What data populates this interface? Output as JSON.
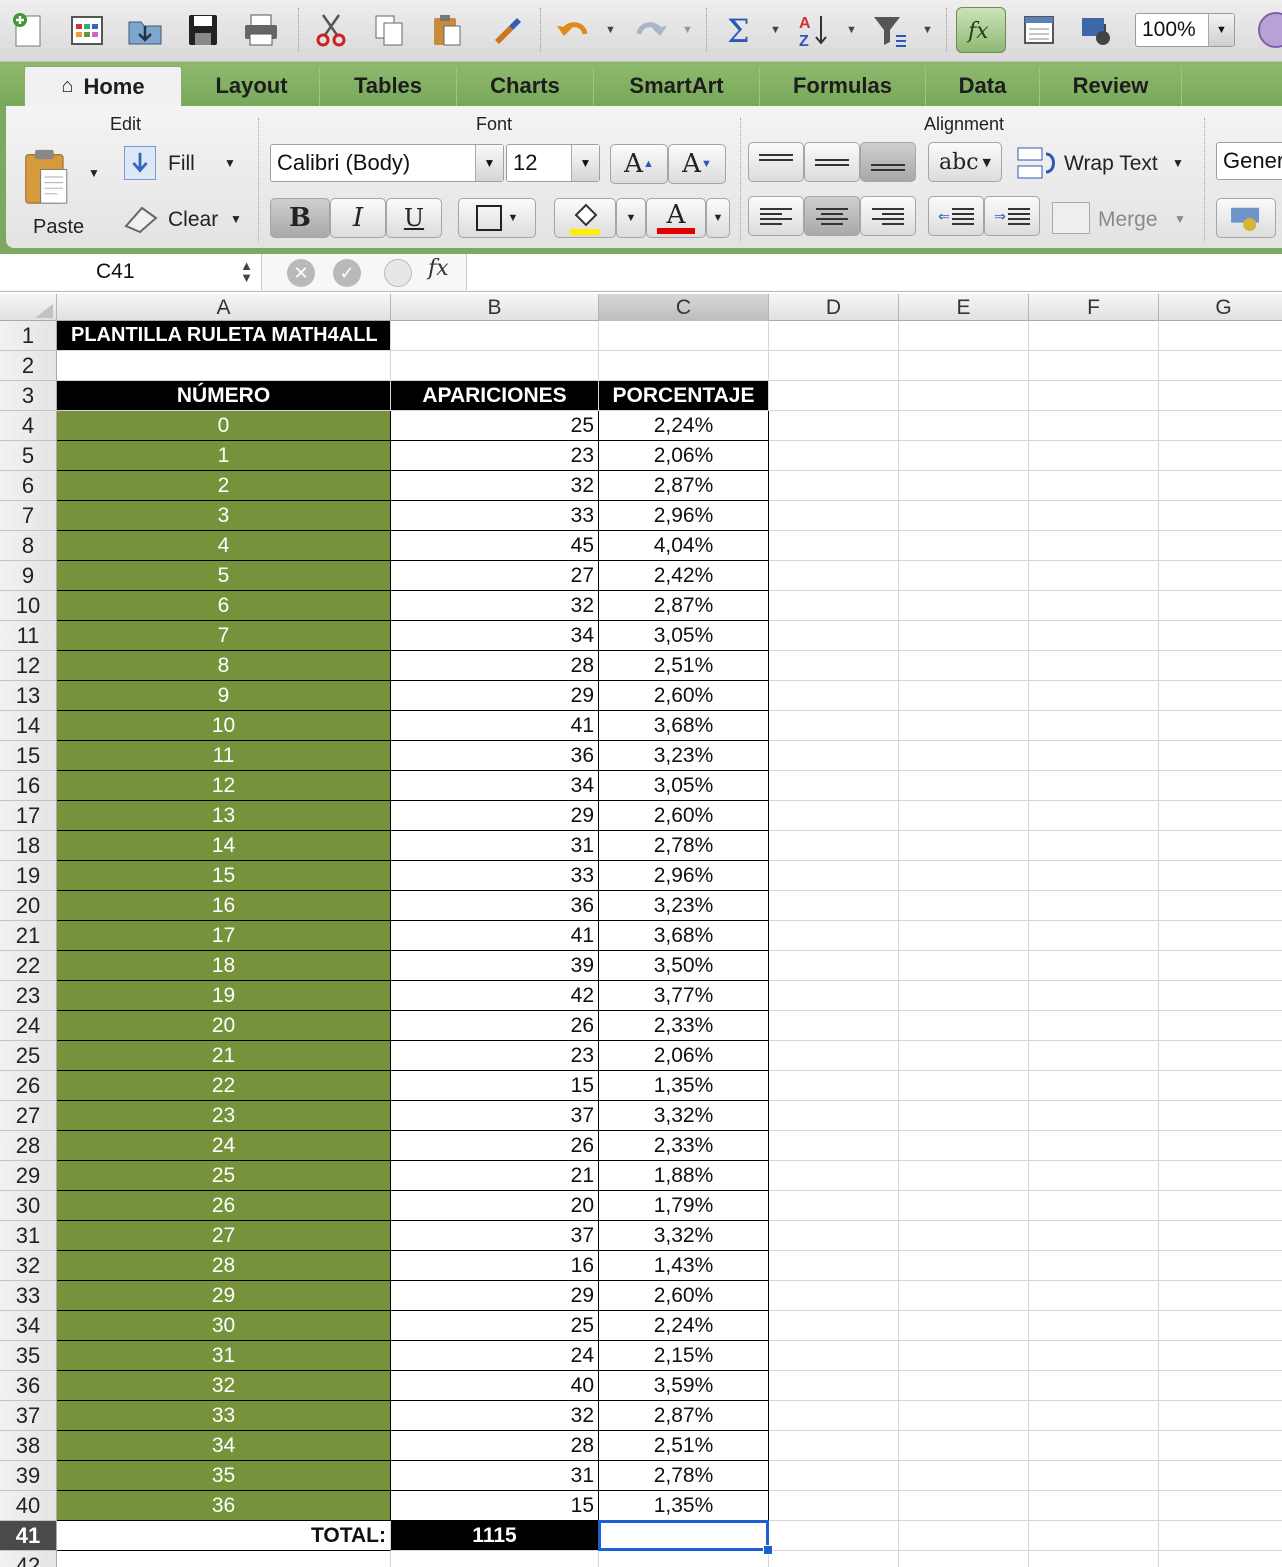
{
  "toolbar": {
    "zoom": "100%",
    "icons": [
      "new-icon",
      "gallery-icon",
      "open-icon",
      "save-icon",
      "print-icon",
      "cut-icon",
      "copy-icon",
      "paste-icon",
      "format-brush-icon",
      "undo-icon",
      "redo-icon",
      "autosum-icon",
      "sort-icon",
      "filter-icon",
      "function-icon",
      "show-formula-icon",
      "media-icon"
    ]
  },
  "tabs": [
    "Home",
    "Layout",
    "Tables",
    "Charts",
    "SmartArt",
    "Formulas",
    "Data",
    "Review"
  ],
  "ribbon": {
    "edit": {
      "title": "Edit",
      "paste": "Paste",
      "fill": "Fill",
      "clear": "Clear"
    },
    "font": {
      "title": "Font",
      "family": "Calibri (Body)",
      "size": "12",
      "bold": "B",
      "italic": "I",
      "underline": "U",
      "grow": "A",
      "shrink": "A",
      "color": "A"
    },
    "alignment": {
      "title": "Alignment",
      "wrap": "Wrap Text",
      "merge": "Merge",
      "orient": "abc"
    },
    "number": {
      "format": "Gener"
    }
  },
  "formula_bar": {
    "name_box": "C41",
    "formula": "",
    "fx": "fx"
  },
  "columns": [
    "A",
    "B",
    "C",
    "D",
    "E",
    "F",
    "G"
  ],
  "sheet": {
    "title": "PLANTILLA RULETA MATH4ALL",
    "headers": [
      "NÚMERO",
      "APARICIONES",
      "PORCENTAJE"
    ],
    "rows": [
      [
        "0",
        "25",
        "2,24%"
      ],
      [
        "1",
        "23",
        "2,06%"
      ],
      [
        "2",
        "32",
        "2,87%"
      ],
      [
        "3",
        "33",
        "2,96%"
      ],
      [
        "4",
        "45",
        "4,04%"
      ],
      [
        "5",
        "27",
        "2,42%"
      ],
      [
        "6",
        "32",
        "2,87%"
      ],
      [
        "7",
        "34",
        "3,05%"
      ],
      [
        "8",
        "28",
        "2,51%"
      ],
      [
        "9",
        "29",
        "2,60%"
      ],
      [
        "10",
        "41",
        "3,68%"
      ],
      [
        "11",
        "36",
        "3,23%"
      ],
      [
        "12",
        "34",
        "3,05%"
      ],
      [
        "13",
        "29",
        "2,60%"
      ],
      [
        "14",
        "31",
        "2,78%"
      ],
      [
        "15",
        "33",
        "2,96%"
      ],
      [
        "16",
        "36",
        "3,23%"
      ],
      [
        "17",
        "41",
        "3,68%"
      ],
      [
        "18",
        "39",
        "3,50%"
      ],
      [
        "19",
        "42",
        "3,77%"
      ],
      [
        "20",
        "26",
        "2,33%"
      ],
      [
        "21",
        "23",
        "2,06%"
      ],
      [
        "22",
        "15",
        "1,35%"
      ],
      [
        "23",
        "37",
        "3,32%"
      ],
      [
        "24",
        "26",
        "2,33%"
      ],
      [
        "25",
        "21",
        "1,88%"
      ],
      [
        "26",
        "20",
        "1,79%"
      ],
      [
        "27",
        "37",
        "3,32%"
      ],
      [
        "28",
        "16",
        "1,43%"
      ],
      [
        "29",
        "29",
        "2,60%"
      ],
      [
        "30",
        "25",
        "2,24%"
      ],
      [
        "31",
        "24",
        "2,15%"
      ],
      [
        "32",
        "40",
        "3,59%"
      ],
      [
        "33",
        "32",
        "2,87%"
      ],
      [
        "34",
        "28",
        "2,51%"
      ],
      [
        "35",
        "31",
        "2,78%"
      ],
      [
        "36",
        "15",
        "1,35%"
      ]
    ],
    "total_label": "TOTAL:",
    "total_value": "1115",
    "row_numbers": [
      "1",
      "2",
      "3",
      "4",
      "5",
      "6",
      "7",
      "8",
      "9",
      "10",
      "11",
      "12",
      "13",
      "14",
      "15",
      "16",
      "17",
      "18",
      "19",
      "20",
      "21",
      "22",
      "23",
      "24",
      "25",
      "26",
      "27",
      "28",
      "29",
      "30",
      "31",
      "32",
      "33",
      "34",
      "35",
      "36",
      "37",
      "38",
      "39",
      "40",
      "41",
      "42"
    ]
  },
  "colors": {
    "green": "#76933c",
    "black": "#000000",
    "selection": "#1e5fd3",
    "tab_green": "#7ea862"
  }
}
